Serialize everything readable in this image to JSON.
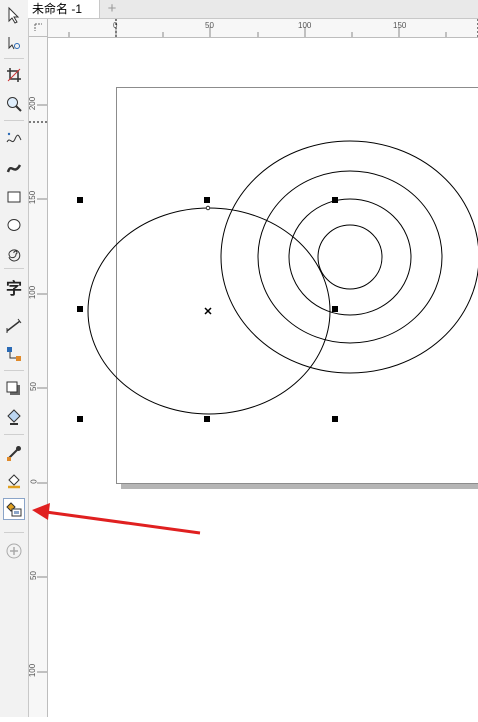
{
  "document": {
    "tab_title": "未命名 -1",
    "add_tab_symbol": "+"
  },
  "rulers": {
    "horizontal_labels": [
      "0",
      "50",
      "100",
      "150"
    ],
    "vertical_labels": [
      "200",
      "150",
      "100",
      "50",
      "0",
      "50",
      "100"
    ]
  },
  "toolbox": {
    "tools": [
      "pick-tool",
      "shape-tool",
      "crop-tool",
      "zoom-tool",
      "freehand-tool",
      "artistic-media-tool",
      "rectangle-tool",
      "ellipse-tool",
      "spiral-tool",
      "text-tool",
      "dimension-tool",
      "connector-tool",
      "drop-shadow-tool",
      "transparency-tool",
      "eyedropper-tool",
      "interactive-fill-tool",
      "smart-fill-tool",
      "add-tool"
    ],
    "text_tool_glyph": "字",
    "active_tool": "smart-fill-tool"
  },
  "annotation": {
    "arrow_color": "#e02020",
    "points_to": "smart-fill-tool"
  }
}
